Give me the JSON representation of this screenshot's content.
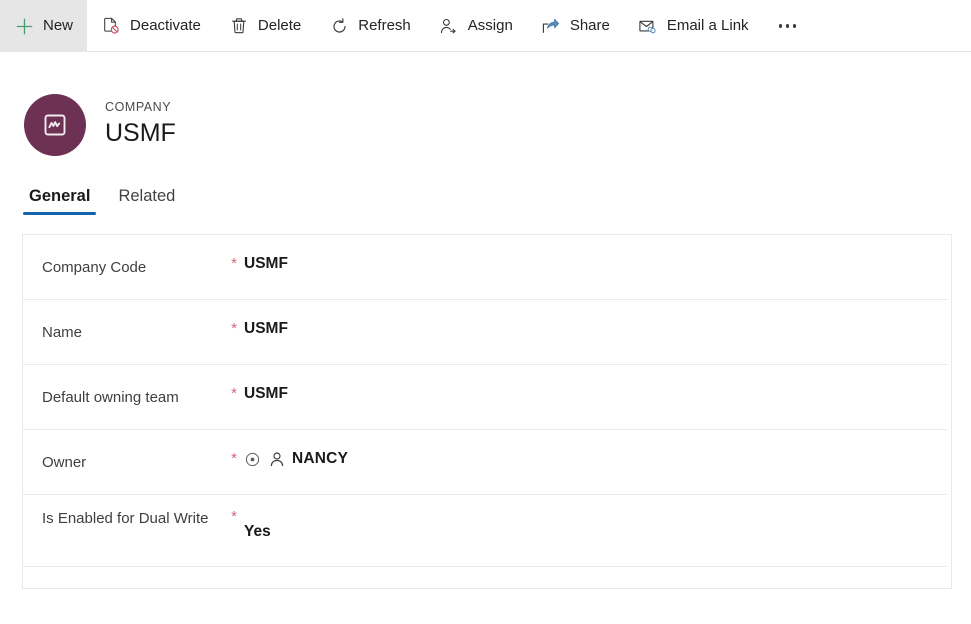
{
  "commandbar": {
    "items": [
      {
        "label": "New",
        "icon": "plus-icon",
        "selected": true
      },
      {
        "label": "Deactivate",
        "icon": "deactivate-icon",
        "selected": false
      },
      {
        "label": "Delete",
        "icon": "trash-icon",
        "selected": false
      },
      {
        "label": "Refresh",
        "icon": "refresh-icon",
        "selected": false
      },
      {
        "label": "Assign",
        "icon": "assign-icon",
        "selected": false
      },
      {
        "label": "Share",
        "icon": "share-icon",
        "selected": false
      },
      {
        "label": "Email a Link",
        "icon": "email-link-icon",
        "selected": false
      }
    ],
    "overflow_label": "…",
    "overflow_icon": "more-icon"
  },
  "record": {
    "entity_label": "COMPANY",
    "title": "USMF",
    "avatar_icon": "company-icon",
    "avatar_color": "#6d3154"
  },
  "tabs": [
    {
      "label": "General",
      "active": true
    },
    {
      "label": "Related",
      "active": false
    }
  ],
  "form": {
    "rows": [
      {
        "label": "Company Code",
        "required": "*",
        "value": "USMF",
        "type": "text"
      },
      {
        "label": "Name",
        "required": "*",
        "value": "USMF",
        "type": "text"
      },
      {
        "label": "Default owning team",
        "required": "*",
        "value": "USMF",
        "type": "text"
      },
      {
        "label": "Owner",
        "required": "*",
        "value": "NANCY",
        "type": "lookup"
      },
      {
        "label": "Is Enabled for Dual Write",
        "required": "*",
        "value": "Yes",
        "type": "text"
      }
    ],
    "lookup_icons": [
      "recent-icon",
      "person-icon"
    ]
  },
  "colors": {
    "accent": "#1463ad",
    "required": "#d06a7a",
    "new_icon": "#4a9b6e",
    "share_icon": "#4a7ba7"
  }
}
